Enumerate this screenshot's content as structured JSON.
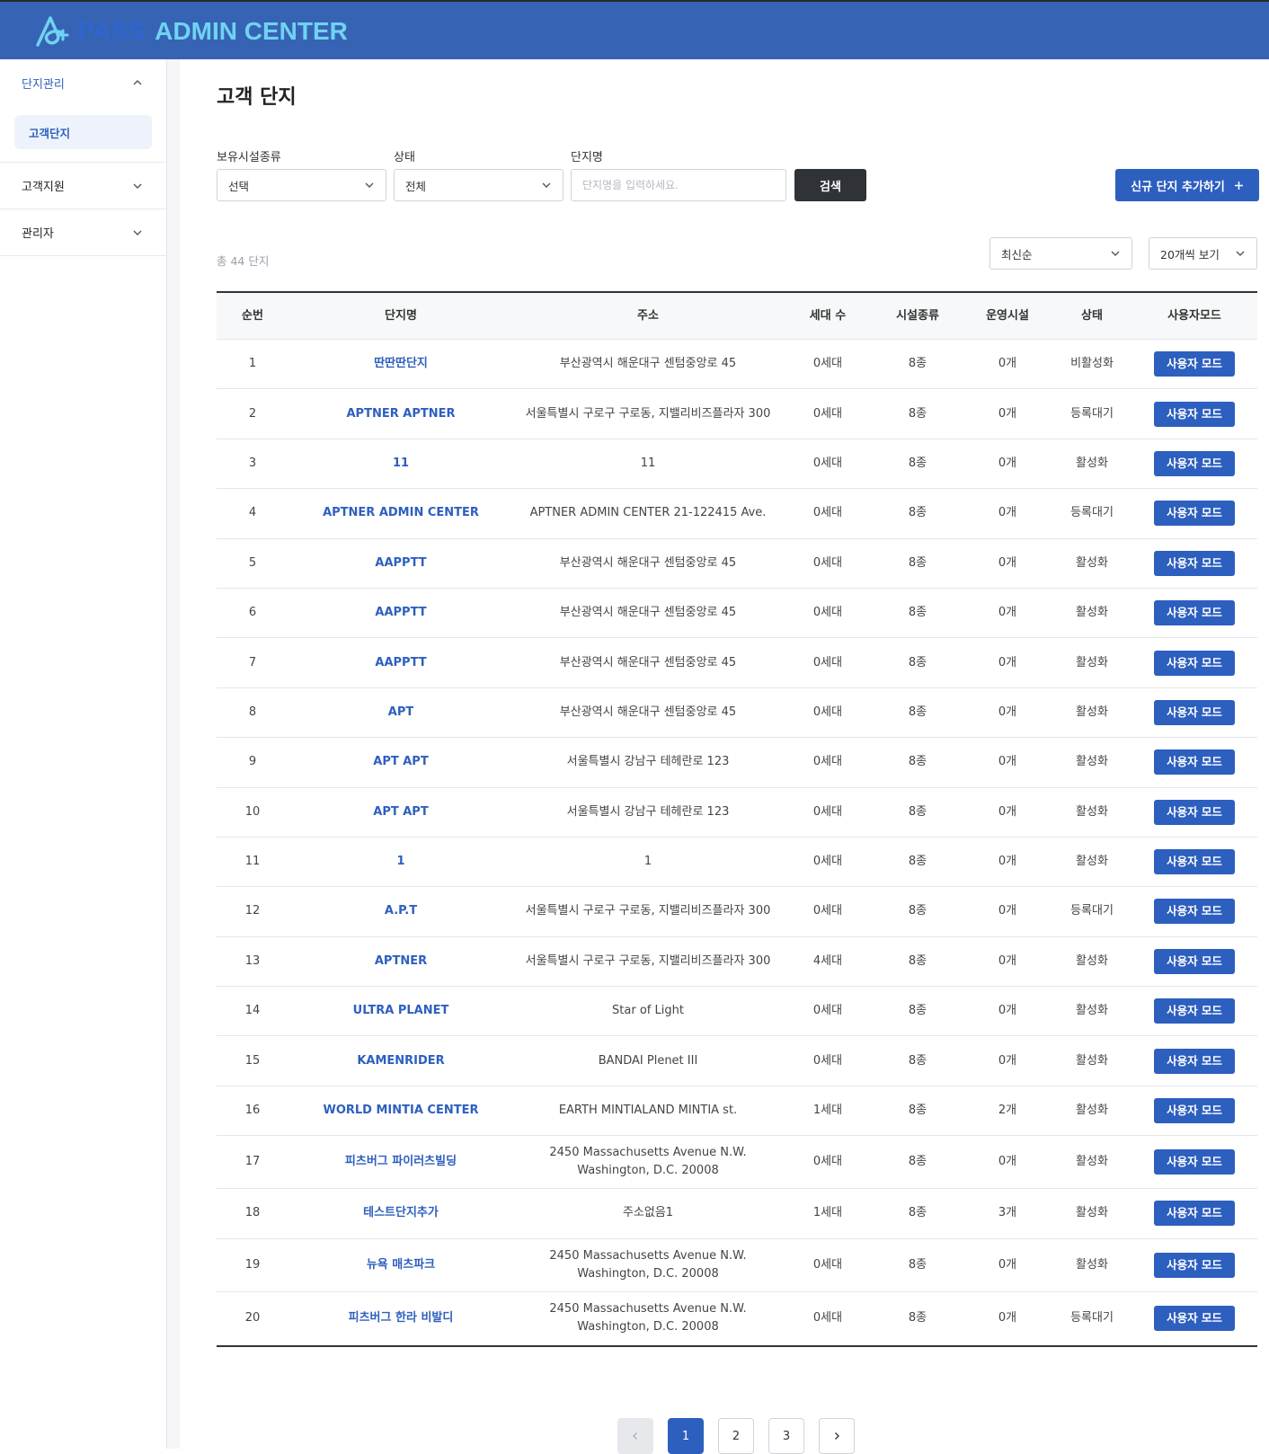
{
  "header": {
    "logo_pass": "PASS",
    "logo_admin": "ADMIN CENTER"
  },
  "sidebar": {
    "groups": [
      {
        "label": "단지관리",
        "open": true,
        "items": [
          {
            "label": "고객단지"
          }
        ]
      },
      {
        "label": "고객지원",
        "open": false
      },
      {
        "label": "관리자",
        "open": false
      }
    ]
  },
  "page": {
    "title": "고객 단지"
  },
  "filters": {
    "facility_type": {
      "label": "보유시설종류",
      "value": "선택"
    },
    "status": {
      "label": "상태",
      "value": "전체"
    },
    "complex_name": {
      "label": "단지명",
      "placeholder": "단지명을 입력하세요."
    },
    "search_label": "검색",
    "new_label": "신규 단지 추가하기",
    "new_icon": "plus-icon"
  },
  "list": {
    "total": "총 44 단지",
    "sort": "최신순",
    "page_size": "20개씩 보기"
  },
  "table": {
    "headers": [
      "순번",
      "단지명",
      "주소",
      "세대 수",
      "시설종류",
      "운영시설",
      "상태",
      "사용자모드"
    ],
    "rows": [
      {
        "no": "1",
        "name": "딴딴딴단지",
        "address": [
          "부산광역시 해운대구 센텀중앙로 45"
        ],
        "households": "0세대",
        "facility_types": "8종",
        "operating": "0개",
        "status": "비활성화",
        "mode": "사용자 모드"
      },
      {
        "no": "2",
        "name": "APTNER APTNER",
        "address": [
          "서울특별시 구로구 구로동, 지밸리비즈플라자 300"
        ],
        "households": "0세대",
        "facility_types": "8종",
        "operating": "0개",
        "status": "등록대기",
        "mode": "사용자 모드"
      },
      {
        "no": "3",
        "name": "11",
        "address": [
          "11"
        ],
        "households": "0세대",
        "facility_types": "8종",
        "operating": "0개",
        "status": "활성화",
        "mode": "사용자 모드"
      },
      {
        "no": "4",
        "name": "APTNER ADMIN CENTER",
        "address": [
          "APTNER ADMIN CENTER 21-122415 Ave."
        ],
        "households": "0세대",
        "facility_types": "8종",
        "operating": "0개",
        "status": "등록대기",
        "mode": "사용자 모드"
      },
      {
        "no": "5",
        "name": "AAPPTT",
        "address": [
          "부산광역시 해운대구 센텀중앙로 45"
        ],
        "households": "0세대",
        "facility_types": "8종",
        "operating": "0개",
        "status": "활성화",
        "mode": "사용자 모드"
      },
      {
        "no": "6",
        "name": "AAPPTT",
        "address": [
          "부산광역시 해운대구 센텀중앙로 45"
        ],
        "households": "0세대",
        "facility_types": "8종",
        "operating": "0개",
        "status": "활성화",
        "mode": "사용자 모드"
      },
      {
        "no": "7",
        "name": "AAPPTT",
        "address": [
          "부산광역시 해운대구 센텀중앙로 45"
        ],
        "households": "0세대",
        "facility_types": "8종",
        "operating": "0개",
        "status": "활성화",
        "mode": "사용자 모드"
      },
      {
        "no": "8",
        "name": "APT",
        "address": [
          "부산광역시 해운대구 센텀중앙로 45"
        ],
        "households": "0세대",
        "facility_types": "8종",
        "operating": "0개",
        "status": "활성화",
        "mode": "사용자 모드"
      },
      {
        "no": "9",
        "name": "APT APT",
        "address": [
          "서울특별시 강남구 테헤란로 123"
        ],
        "households": "0세대",
        "facility_types": "8종",
        "operating": "0개",
        "status": "활성화",
        "mode": "사용자 모드"
      },
      {
        "no": "10",
        "name": "APT APT",
        "address": [
          "서울특별시 강남구 테헤란로 123"
        ],
        "households": "0세대",
        "facility_types": "8종",
        "operating": "0개",
        "status": "활성화",
        "mode": "사용자 모드"
      },
      {
        "no": "11",
        "name": "1",
        "address": [
          "1"
        ],
        "households": "0세대",
        "facility_types": "8종",
        "operating": "0개",
        "status": "활성화",
        "mode": "사용자 모드"
      },
      {
        "no": "12",
        "name": "A.P.T",
        "address": [
          "서울특별시 구로구 구로동, 지밸리비즈플라자 300"
        ],
        "households": "0세대",
        "facility_types": "8종",
        "operating": "0개",
        "status": "등록대기",
        "mode": "사용자 모드"
      },
      {
        "no": "13",
        "name": "APTNER",
        "address": [
          "서울특별시 구로구 구로동, 지밸리비즈플라자 300"
        ],
        "households": "4세대",
        "facility_types": "8종",
        "operating": "0개",
        "status": "활성화",
        "mode": "사용자 모드"
      },
      {
        "no": "14",
        "name": "ULTRA PLANET",
        "address": [
          "Star of Light"
        ],
        "households": "0세대",
        "facility_types": "8종",
        "operating": "0개",
        "status": "활성화",
        "mode": "사용자 모드"
      },
      {
        "no": "15",
        "name": "KAMENRIDER",
        "address": [
          "BANDAI Plenet III"
        ],
        "households": "0세대",
        "facility_types": "8종",
        "operating": "0개",
        "status": "활성화",
        "mode": "사용자 모드"
      },
      {
        "no": "16",
        "name": "WORLD MINTIA CENTER",
        "address": [
          "EARTH MINTIALAND MINTIA st."
        ],
        "households": "1세대",
        "facility_types": "8종",
        "operating": "2개",
        "status": "활성화",
        "mode": "사용자 모드"
      },
      {
        "no": "17",
        "name": "피츠버그 파이러츠빌딩",
        "address": [
          "2450 Massachusetts Avenue N.W.",
          "Washington, D.C. 20008"
        ],
        "households": "0세대",
        "facility_types": "8종",
        "operating": "0개",
        "status": "활성화",
        "mode": "사용자 모드"
      },
      {
        "no": "18",
        "name": "테스트단지추가",
        "address": [
          "주소없음1"
        ],
        "households": "1세대",
        "facility_types": "8종",
        "operating": "3개",
        "status": "활성화",
        "mode": "사용자 모드"
      },
      {
        "no": "19",
        "name": "뉴욕 매츠파크",
        "address": [
          "2450 Massachusetts Avenue N.W.",
          "Washington, D.C. 20008"
        ],
        "households": "0세대",
        "facility_types": "8종",
        "operating": "0개",
        "status": "활성화",
        "mode": "사용자 모드"
      },
      {
        "no": "20",
        "name": "피츠버그 한라 비발디",
        "address": [
          "2450 Massachusetts Avenue N.W.",
          "Washington, D.C. 20008"
        ],
        "households": "0세대",
        "facility_types": "8종",
        "operating": "0개",
        "status": "등록대기",
        "mode": "사용자 모드"
      }
    ]
  },
  "pagination": {
    "prev_icon": "chevron-left-icon",
    "next_icon": "chevron-right-icon",
    "pages": [
      "1",
      "2",
      "3"
    ],
    "current": "1"
  },
  "colors": {
    "header_bg": "#3763b5",
    "accent": "#2d5fbf",
    "search_btn": "#2f3337"
  }
}
